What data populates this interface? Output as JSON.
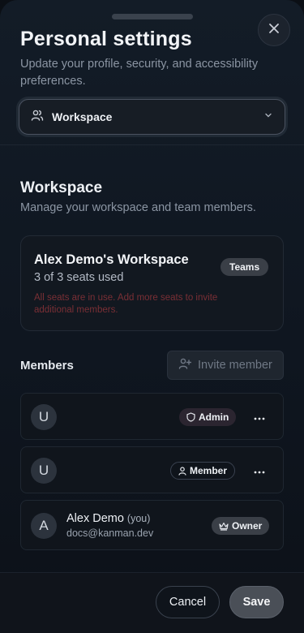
{
  "header": {
    "title": "Personal settings",
    "subtitle": "Update your profile, security, and accessibility preferences."
  },
  "section_select": {
    "value": "Workspace",
    "icon": "users-icon"
  },
  "workspace": {
    "title": "Workspace",
    "subtitle": "Manage your workspace and team members.",
    "name": "Alex Demo's Workspace",
    "seats": "3 of 3 seats used",
    "plan_badge": "Teams",
    "warning": "All seats are in use. Add more seats to invite additional members."
  },
  "members": {
    "label": "Members",
    "invite_label": "Invite member",
    "list": [
      {
        "initial": "U",
        "name": "",
        "you": "",
        "email": "",
        "role": "Admin",
        "role_icon": "shield-icon"
      },
      {
        "initial": "U",
        "name": "",
        "you": "",
        "email": "",
        "role": "Member",
        "role_icon": "user-icon"
      },
      {
        "initial": "A",
        "name": "Alex Demo",
        "you": "(you)",
        "email": "docs@kanman.dev",
        "role": "Owner",
        "role_icon": "crown-icon"
      }
    ]
  },
  "footer": {
    "cancel_label": "Cancel",
    "save_label": "Save"
  },
  "colors": {
    "warning": "#7a2f35",
    "background": "#131c27"
  }
}
